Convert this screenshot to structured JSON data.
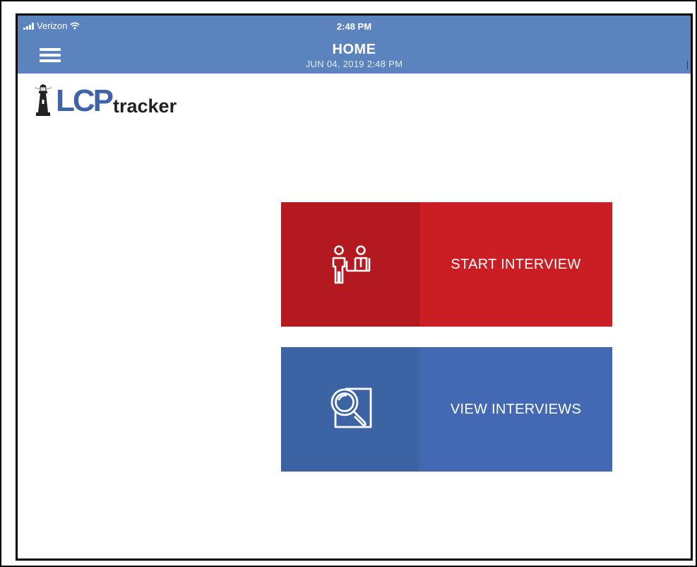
{
  "status_bar": {
    "carrier": "Verizon",
    "time": "2:48 PM"
  },
  "header": {
    "title": "HOME",
    "subtitle": "JUN 04, 2019 2:48 PM",
    "menu_icon": "hamburger-menu-icon"
  },
  "logo": {
    "lcp": "LCP",
    "tracker": "tracker",
    "icon": "lighthouse-icon"
  },
  "actions": [
    {
      "label": "START INTERVIEW",
      "icon": "interview-people-icon",
      "color": "#cb1e24",
      "icon_bg": "#b3191f"
    },
    {
      "label": "VIEW INTERVIEWS",
      "icon": "magnifier-document-icon",
      "color": "#4369b5",
      "icon_bg": "#3c63a4"
    }
  ],
  "colors": {
    "header_bg": "#5b83bd",
    "logo_blue": "#3f63a8"
  }
}
